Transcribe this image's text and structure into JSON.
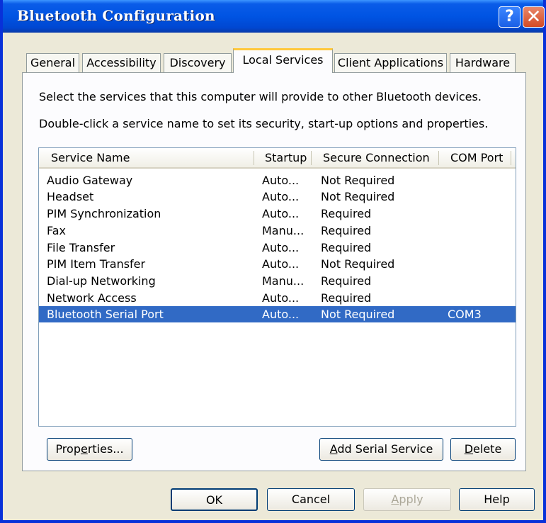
{
  "window": {
    "title": "Bluetooth Configuration",
    "help_glyph": "?",
    "close_glyph": "✕"
  },
  "tabs": [
    {
      "label": "General"
    },
    {
      "label": "Accessibility"
    },
    {
      "label": "Discovery"
    },
    {
      "label": "Local Services",
      "active": true
    },
    {
      "label": "Client Applications"
    },
    {
      "label": "Hardware"
    }
  ],
  "panel": {
    "line1": "Select the services that this computer will provide to other Bluetooth devices.",
    "line2": "Double-click a service name to set its security, start-up options and properties."
  },
  "list": {
    "columns": [
      "Service Name",
      "Startup",
      "Secure Connection",
      "COM Port"
    ],
    "rows": [
      {
        "name": "Audio Gateway",
        "startup": "Auto...",
        "secure": "Not Required",
        "com": ""
      },
      {
        "name": "Headset",
        "startup": "Auto...",
        "secure": "Not Required",
        "com": ""
      },
      {
        "name": "PIM Synchronization",
        "startup": "Auto...",
        "secure": "Required",
        "com": ""
      },
      {
        "name": "Fax",
        "startup": "Manu...",
        "secure": "Required",
        "com": ""
      },
      {
        "name": "File Transfer",
        "startup": "Auto...",
        "secure": "Required",
        "com": ""
      },
      {
        "name": "PIM Item Transfer",
        "startup": "Auto...",
        "secure": "Not Required",
        "com": ""
      },
      {
        "name": "Dial-up Networking",
        "startup": "Manu...",
        "secure": "Required",
        "com": ""
      },
      {
        "name": "Network Access",
        "startup": "Auto...",
        "secure": "Required",
        "com": ""
      },
      {
        "name": "Bluetooth Serial Port",
        "startup": "Auto...",
        "secure": "Not Required",
        "com": "COM3",
        "selected": true
      }
    ]
  },
  "buttons": {
    "properties_a": "Prop",
    "properties_u": "e",
    "properties_b": "rties...",
    "add_serial_u": "A",
    "add_serial_b": "dd Serial Service",
    "delete_u": "D",
    "delete_b": "elete",
    "ok": "OK",
    "cancel": "Cancel",
    "apply_u": "A",
    "apply_b": "pply",
    "help": "Help"
  },
  "colors": {
    "titlebar": "#0054e3",
    "selection": "#316ac5",
    "active_tab_accent": "#ffc83c",
    "dialog_bg": "#ece9d8"
  }
}
